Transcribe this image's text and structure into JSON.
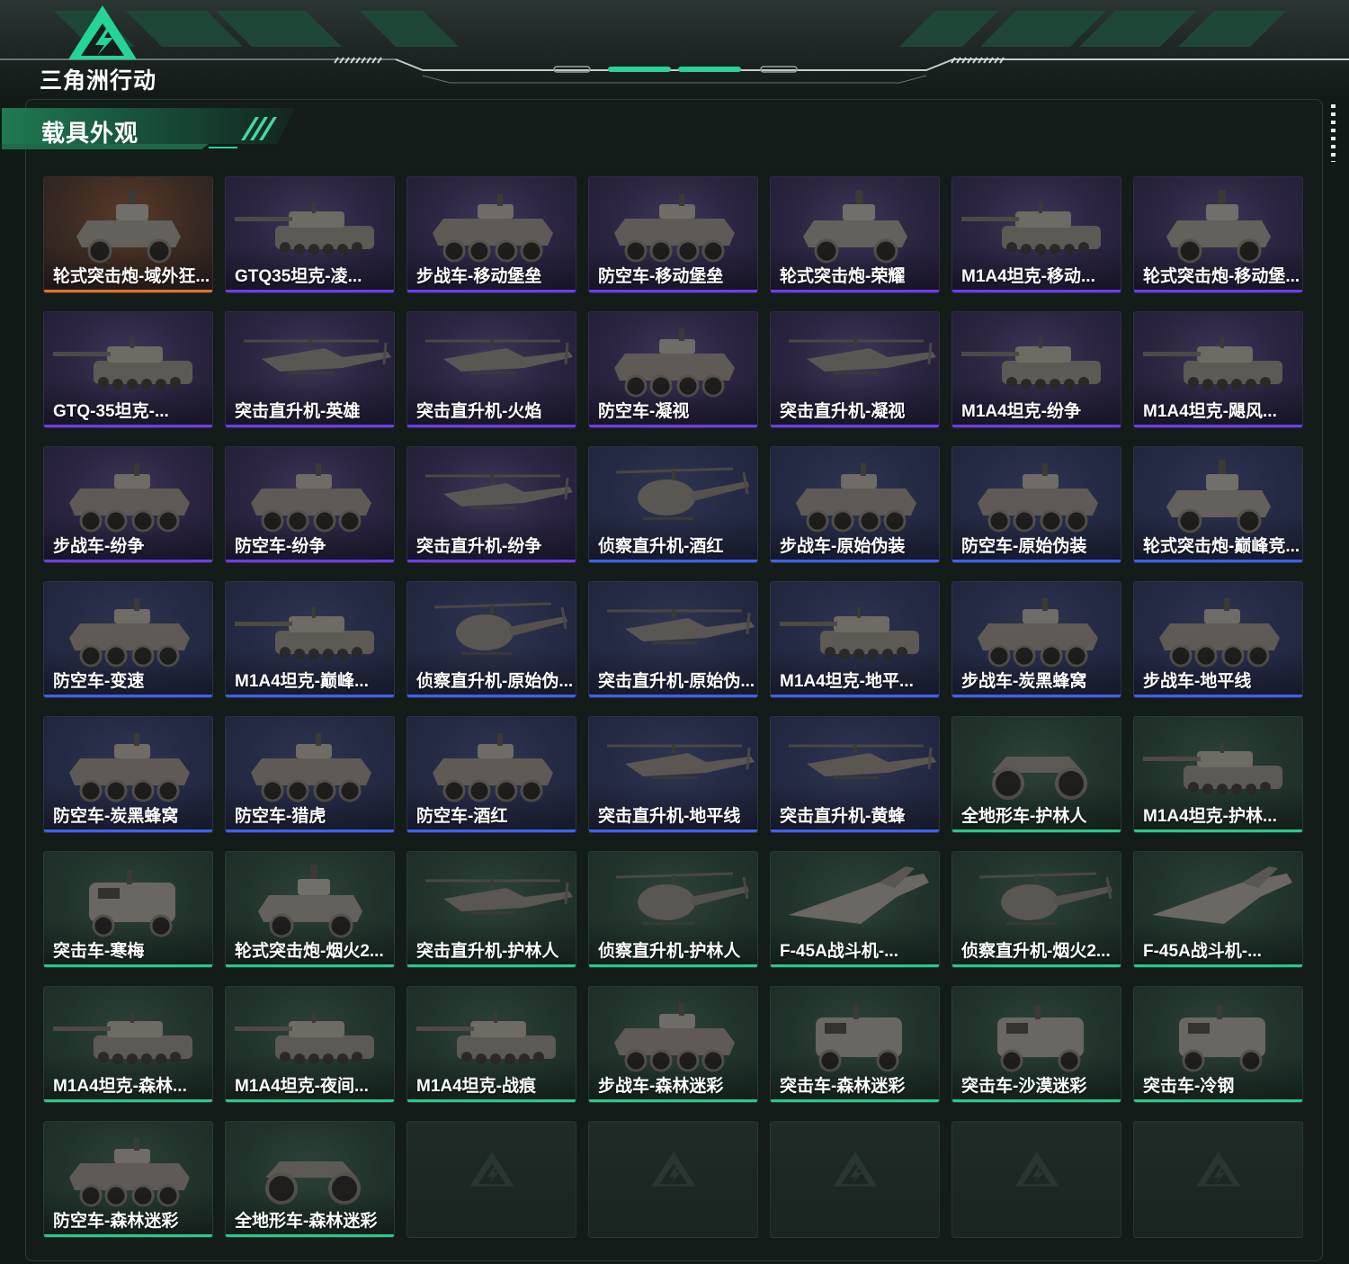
{
  "app": {
    "logo_text": "三角洲行动",
    "accent": "#2ad19a"
  },
  "section": {
    "title": "载具外观"
  },
  "colors": {
    "purple": "#6a3cf0",
    "orange": "#e2712a",
    "blue": "#3a62f0",
    "green": "#27c98a"
  },
  "items": [
    {
      "label": "轮式突击炮-域外狂...",
      "rarity": "orange",
      "icon": "wheeled-assault-gun"
    },
    {
      "label": "GTQ35坦克-凌...",
      "rarity": "purple",
      "icon": "tank"
    },
    {
      "label": "步战车-移动堡垒",
      "rarity": "purple",
      "icon": "ifv"
    },
    {
      "label": "防空车-移动堡垒",
      "rarity": "purple",
      "icon": "ifv"
    },
    {
      "label": "轮式突击炮-荣耀",
      "rarity": "purple",
      "icon": "wheeled-assault-gun"
    },
    {
      "label": "M1A4坦克-移动...",
      "rarity": "purple",
      "icon": "tank"
    },
    {
      "label": "轮式突击炮-移动堡...",
      "rarity": "purple",
      "icon": "wheeled-assault-gun"
    },
    {
      "label": "GTQ-35坦克-...",
      "rarity": "purple",
      "icon": "tank"
    },
    {
      "label": "突击直升机-英雄",
      "rarity": "purple",
      "icon": "attack-helicopter"
    },
    {
      "label": "突击直升机-火焰",
      "rarity": "purple",
      "icon": "attack-helicopter"
    },
    {
      "label": "防空车-凝视",
      "rarity": "purple",
      "icon": "ifv"
    },
    {
      "label": "突击直升机-凝视",
      "rarity": "purple",
      "icon": "attack-helicopter"
    },
    {
      "label": "M1A4坦克-纷争",
      "rarity": "purple",
      "icon": "tank"
    },
    {
      "label": "M1A4坦克-飓风...",
      "rarity": "purple",
      "icon": "tank"
    },
    {
      "label": "步战车-纷争",
      "rarity": "purple",
      "icon": "ifv"
    },
    {
      "label": "防空车-纷争",
      "rarity": "purple",
      "icon": "ifv"
    },
    {
      "label": "突击直升机-纷争",
      "rarity": "purple",
      "icon": "attack-helicopter"
    },
    {
      "label": "侦察直升机-酒红",
      "rarity": "blue",
      "icon": "scout-helicopter"
    },
    {
      "label": "步战车-原始伪装",
      "rarity": "blue",
      "icon": "ifv"
    },
    {
      "label": "防空车-原始伪装",
      "rarity": "blue",
      "icon": "ifv"
    },
    {
      "label": "轮式突击炮-巅峰竞...",
      "rarity": "blue",
      "icon": "wheeled-assault-gun"
    },
    {
      "label": "防空车-变速",
      "rarity": "blue",
      "icon": "ifv"
    },
    {
      "label": "M1A4坦克-巅峰...",
      "rarity": "blue",
      "icon": "tank"
    },
    {
      "label": "侦察直升机-原始伪...",
      "rarity": "blue",
      "icon": "scout-helicopter"
    },
    {
      "label": "突击直升机-原始伪...",
      "rarity": "blue",
      "icon": "attack-helicopter"
    },
    {
      "label": "M1A4坦克-地平...",
      "rarity": "blue",
      "icon": "tank"
    },
    {
      "label": "步战车-炭黑蜂窝",
      "rarity": "blue",
      "icon": "ifv"
    },
    {
      "label": "步战车-地平线",
      "rarity": "blue",
      "icon": "ifv"
    },
    {
      "label": "防空车-炭黑蜂窝",
      "rarity": "blue",
      "icon": "ifv"
    },
    {
      "label": "防空车-猎虎",
      "rarity": "blue",
      "icon": "ifv"
    },
    {
      "label": "防空车-酒红",
      "rarity": "blue",
      "icon": "ifv"
    },
    {
      "label": "突击直升机-地平线",
      "rarity": "blue",
      "icon": "attack-helicopter"
    },
    {
      "label": "突击直升机-黄蜂",
      "rarity": "blue",
      "icon": "attack-helicopter"
    },
    {
      "label": "全地形车-护林人",
      "rarity": "green",
      "icon": "atv"
    },
    {
      "label": "M1A4坦克-护林...",
      "rarity": "green",
      "icon": "tank"
    },
    {
      "label": "突击车-寒梅",
      "rarity": "green",
      "icon": "assault-vehicle"
    },
    {
      "label": "轮式突击炮-烟火2...",
      "rarity": "green",
      "icon": "wheeled-assault-gun"
    },
    {
      "label": "突击直升机-护林人",
      "rarity": "green",
      "icon": "attack-helicopter"
    },
    {
      "label": "侦察直升机-护林人",
      "rarity": "green",
      "icon": "scout-helicopter"
    },
    {
      "label": "F-45A战斗机-...",
      "rarity": "green",
      "icon": "fighter-jet"
    },
    {
      "label": "侦察直升机-烟火2...",
      "rarity": "green",
      "icon": "scout-helicopter"
    },
    {
      "label": "F-45A战斗机-...",
      "rarity": "green",
      "icon": "fighter-jet"
    },
    {
      "label": "M1A4坦克-森林...",
      "rarity": "green",
      "icon": "tank"
    },
    {
      "label": "M1A4坦克-夜间...",
      "rarity": "green",
      "icon": "tank"
    },
    {
      "label": "M1A4坦克-战痕",
      "rarity": "green",
      "icon": "tank"
    },
    {
      "label": "步战车-森林迷彩",
      "rarity": "green",
      "icon": "ifv"
    },
    {
      "label": "突击车-森林迷彩",
      "rarity": "green",
      "icon": "assault-vehicle"
    },
    {
      "label": "突击车-沙漠迷彩",
      "rarity": "green",
      "icon": "assault-vehicle"
    },
    {
      "label": "突击车-冷钢",
      "rarity": "green",
      "icon": "assault-vehicle"
    },
    {
      "label": "防空车-森林迷彩",
      "rarity": "green",
      "icon": "ifv"
    },
    {
      "label": "全地形车-森林迷彩",
      "rarity": "green",
      "icon": "atv"
    },
    {
      "label": "",
      "rarity": "empty",
      "icon": "empty-slot"
    },
    {
      "label": "",
      "rarity": "empty",
      "icon": "empty-slot"
    },
    {
      "label": "",
      "rarity": "empty",
      "icon": "empty-slot"
    },
    {
      "label": "",
      "rarity": "empty",
      "icon": "empty-slot"
    },
    {
      "label": "",
      "rarity": "empty",
      "icon": "empty-slot"
    }
  ]
}
